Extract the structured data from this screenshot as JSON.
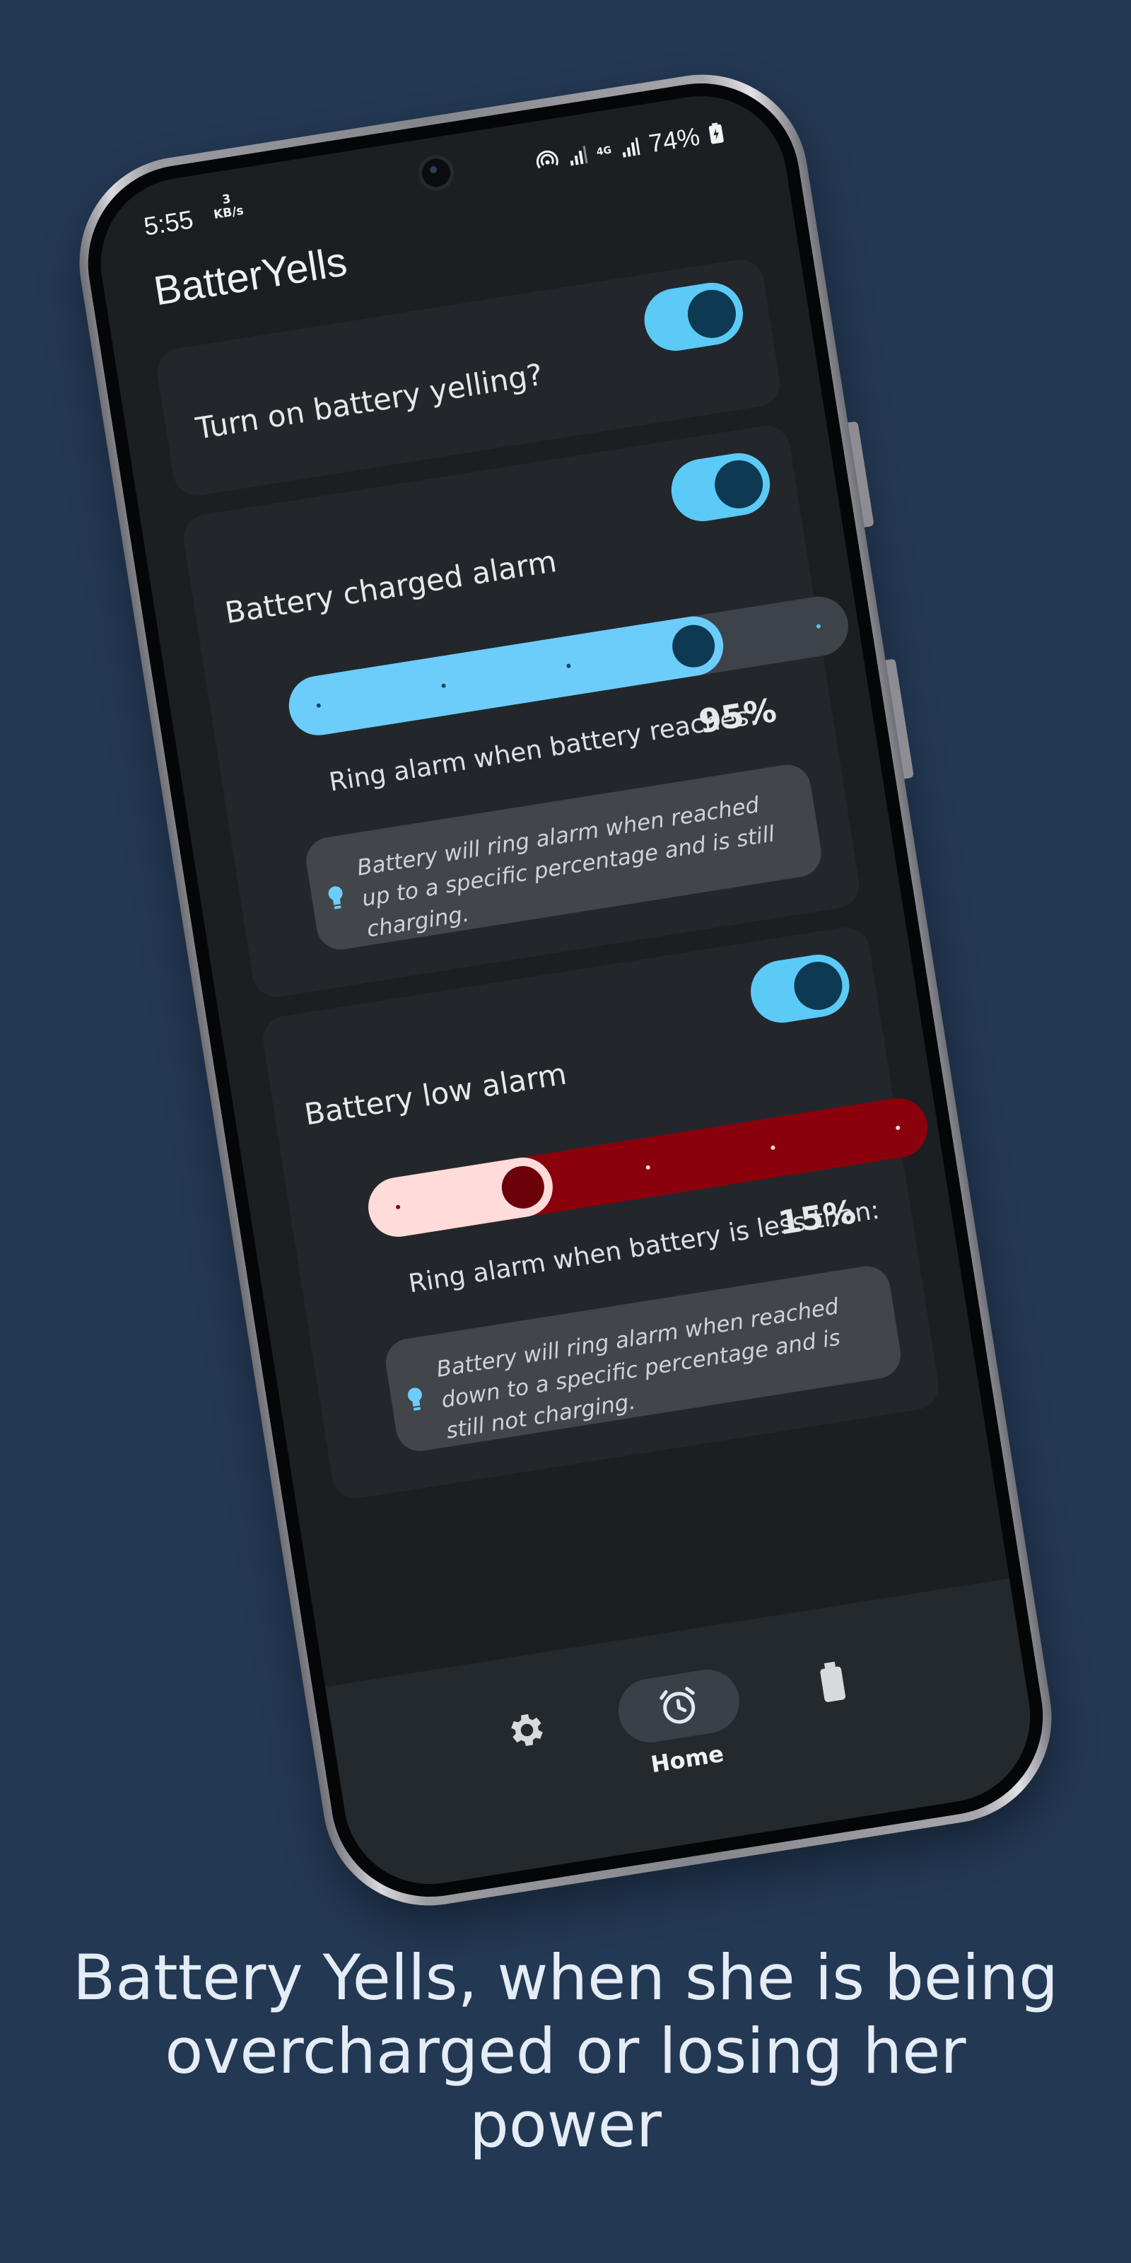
{
  "status_bar": {
    "time": "5:55",
    "net_speed_value": "3",
    "net_speed_unit": "KB/s",
    "network_type": "4G",
    "battery_percent": "74%"
  },
  "app": {
    "title": "BatterYells"
  },
  "master": {
    "label": "Turn on battery yelling?",
    "enabled": true
  },
  "charged_alarm": {
    "label": "Battery charged alarm",
    "enabled": true,
    "slider_level": 0.75,
    "caption": "Ring alarm when battery reaches:",
    "value": "95%",
    "info": "Battery will ring alarm when reached up to a specific percentage and is still charging."
  },
  "low_alarm": {
    "label": "Battery low alarm",
    "enabled": true,
    "slider_level": 0.25,
    "caption": "Ring alarm when battery is less than:",
    "value": "15%",
    "info": "Battery will ring alarm when reached down to a specific percentage and is still not charging."
  },
  "bottom_nav": {
    "items": [
      {
        "icon": "gear-icon",
        "label": ""
      },
      {
        "icon": "alarm-clock-icon",
        "label": "Home",
        "active": true
      },
      {
        "icon": "battery-icon",
        "label": ""
      }
    ]
  },
  "caption": "Battery Yells, when she is being overcharged or losing her power",
  "colors": {
    "background": "#233853",
    "accent_blue": "#6ccdfb",
    "alarm_red": "#8b000d",
    "low_fill": "#ffdcd9"
  }
}
